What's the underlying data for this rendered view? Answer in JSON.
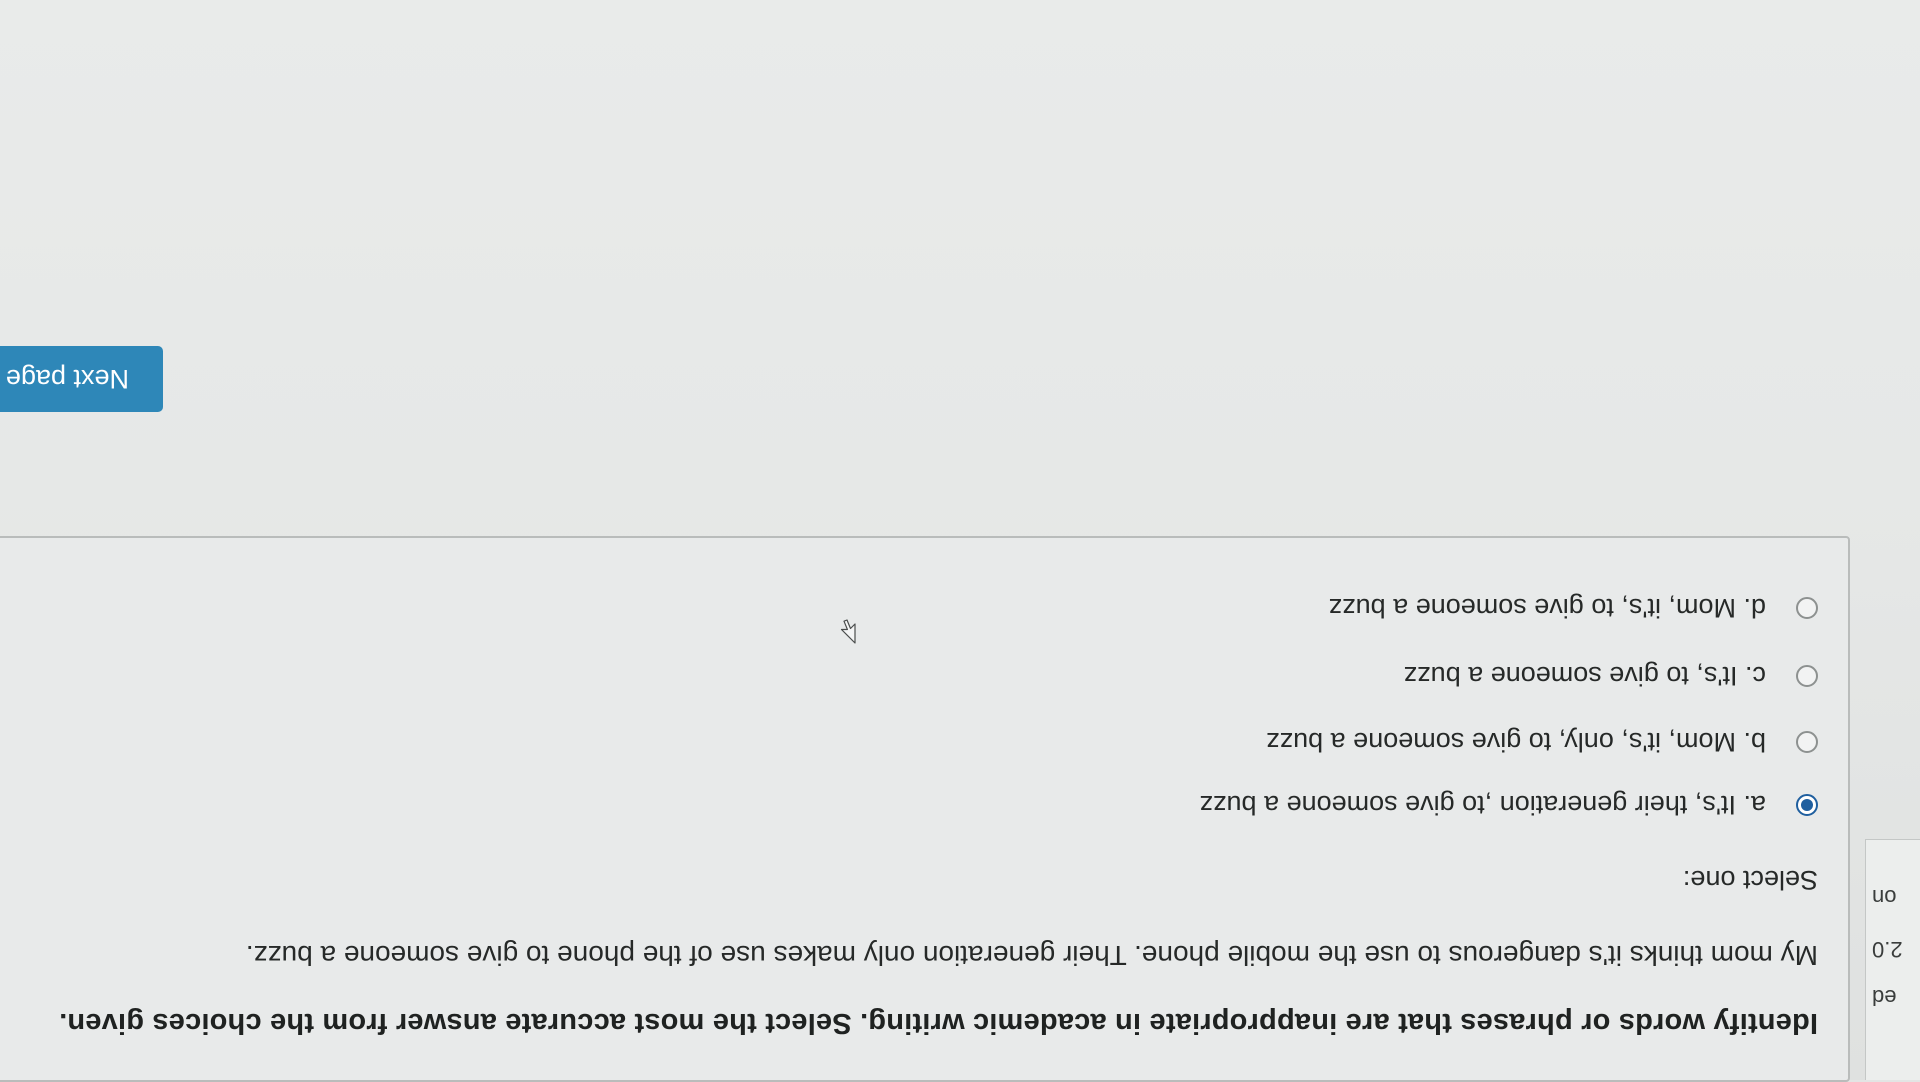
{
  "sidebar": {
    "line1": "ed",
    "line2": "2.0",
    "line3": "on"
  },
  "question": {
    "instruction": "Identify words or phrases that are inappropriate in academic writing. Select the most accurate answer from the choices given.",
    "prompt": "My mom thinks it's dangerous to use the mobile phone. Their generation only makes use of the phone to give someone a buzz.",
    "select_label": "Select one:",
    "options": [
      {
        "label": "a. It's, their generation ,to give someone a buzz",
        "selected": true
      },
      {
        "label": "b. Mom, it's, only, to give someone a buzz",
        "selected": false
      },
      {
        "label": "c. It's, to give someone a buzz",
        "selected": false
      },
      {
        "label": "d. Mom, it's, to give someone a buzz",
        "selected": false
      }
    ]
  },
  "navigation": {
    "next_label": "Next page"
  },
  "colors": {
    "accent": "#2e87b8",
    "radio_selected": "#1f5f9f",
    "background": "#e3e5e4"
  },
  "icons": {
    "cursor": "arrow-cursor-icon"
  }
}
